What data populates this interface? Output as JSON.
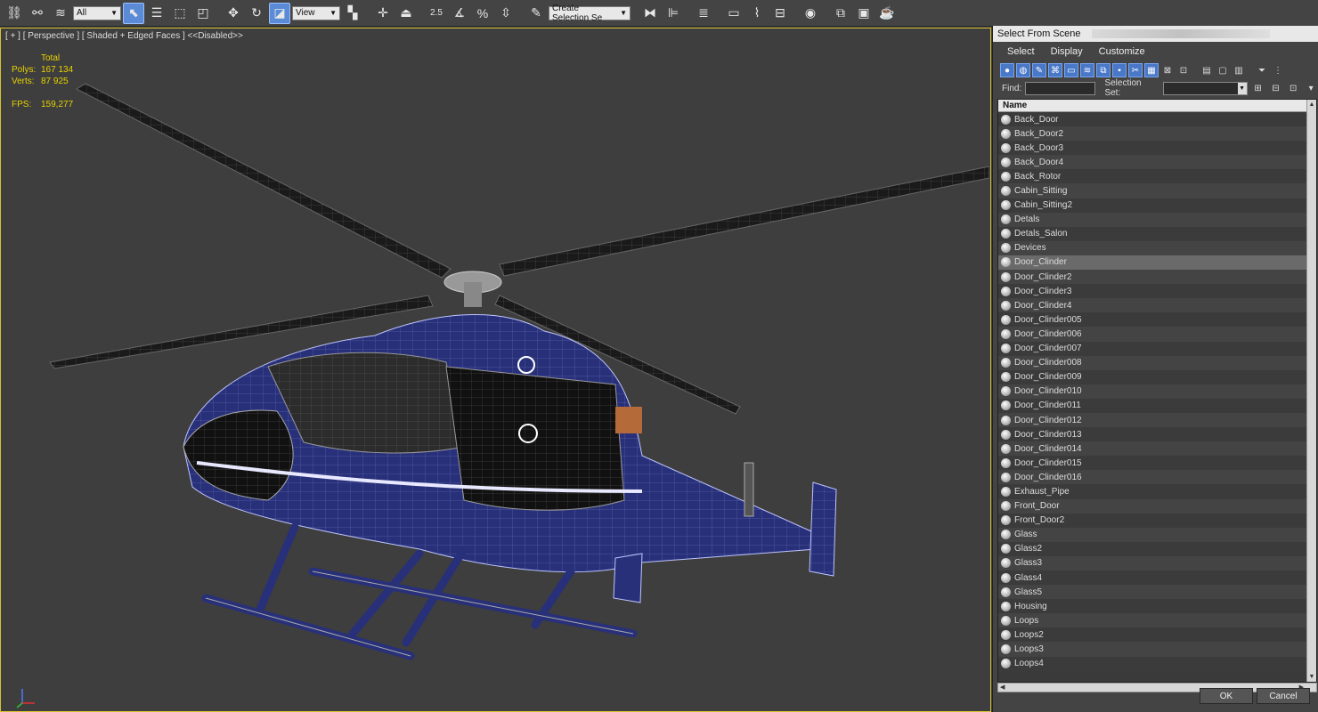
{
  "toolbar": {
    "filter_value": "All",
    "ref_coord_value": "View",
    "snap_label": "2.5",
    "selection_set_placeholder": "Create Selection Se"
  },
  "viewport": {
    "label": "[ + ] [ Perspective ] [ Shaded + Edged Faces ] <<Disabled>>",
    "stats": {
      "total_label": "Total",
      "polys_label": "Polys:",
      "polys_value": "167 134",
      "verts_label": "Verts:",
      "verts_value": "87 925",
      "fps_label": "FPS:",
      "fps_value": "159,277"
    },
    "stats_color": "#e8d200"
  },
  "dialog": {
    "title": "Select From Scene",
    "menu": [
      "Select",
      "Display",
      "Customize"
    ],
    "find_label": "Find:",
    "selection_set_label": "Selection Set:",
    "list_header": "Name",
    "selected_item": "Door_Clinder",
    "items": [
      "Back_Door",
      "Back_Door2",
      "Back_Door3",
      "Back_Door4",
      "Back_Rotor",
      "Cabin_Sitting",
      "Cabin_Sitting2",
      "Detals",
      "Detals_Salon",
      "Devices",
      "Door_Clinder",
      "Door_Clinder2",
      "Door_Clinder3",
      "Door_Clinder4",
      "Door_Clinder005",
      "Door_Clinder006",
      "Door_Clinder007",
      "Door_Clinder008",
      "Door_Clinder009",
      "Door_Clinder010",
      "Door_Clinder011",
      "Door_Clinder012",
      "Door_Clinder013",
      "Door_Clinder014",
      "Door_Clinder015",
      "Door_Clinder016",
      "Exhaust_Pipe",
      "Front_Door",
      "Front_Door2",
      "Glass",
      "Glass2",
      "Glass3",
      "Glass4",
      "Glass5",
      "Housing",
      "Loops",
      "Loops2",
      "Loops3",
      "Loops4"
    ],
    "ok_label": "OK",
    "cancel_label": "Cancel"
  },
  "colors": {
    "viewport_border": "#d6c230",
    "active_tool": "#5b8bd6",
    "helicopter_body": "#28307a"
  }
}
